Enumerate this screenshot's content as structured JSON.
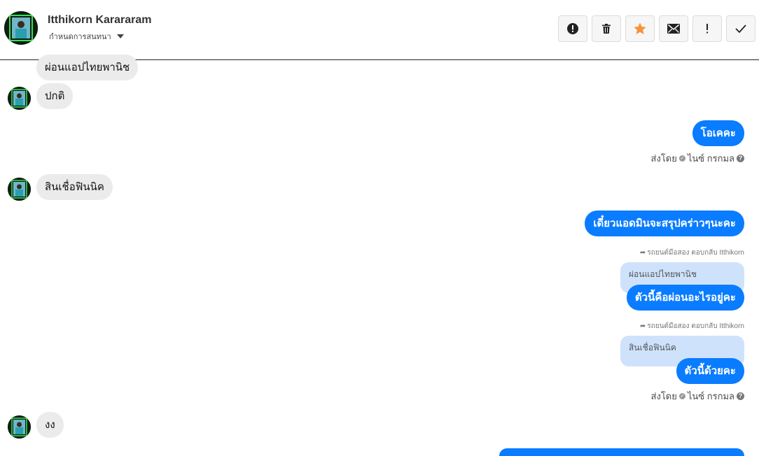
{
  "header": {
    "contact_name": "Itthikorn Karararam",
    "subtitle": "กำหนดการสนทนา",
    "toolbar": [
      {
        "name": "report-button",
        "icon": "alert-circle-icon"
      },
      {
        "name": "delete-button",
        "icon": "trash-icon"
      },
      {
        "name": "star-button",
        "icon": "star-icon"
      },
      {
        "name": "mail-button",
        "icon": "envelope-icon"
      },
      {
        "name": "important-button",
        "icon": "exclamation-icon"
      },
      {
        "name": "done-button",
        "icon": "check-icon"
      }
    ]
  },
  "colors": {
    "outgoing_bubble": "#0a7cff",
    "incoming_bubble": "#ebebeb",
    "quote_bubble": "#cfe2fc",
    "star": "#f7923a"
  },
  "messages": {
    "m1": {
      "text": "ผ่อนแอปไทยพานิช"
    },
    "m2": {
      "text": "ปกติ"
    },
    "m3": {
      "text": "โอเคคะ"
    },
    "m3_sent": {
      "label": "ส่งโดย",
      "name": "ไนซ์ กรกมล",
      "help": "?"
    },
    "m4": {
      "text": "สินเชื่อฟินนิค"
    },
    "m5": {
      "text": "เดี๋ยวแอดมินจะสรุปคร่าวๆนะคะ"
    },
    "m6_reply": {
      "label": "รถยนต์มือสอง ตอบกลับ Itthikorn"
    },
    "m6_quote": {
      "text": "ผ่อนแอปไทยพานิช"
    },
    "m6": {
      "text": "ตัวนี้คือผ่อนอะไรอยู่คะ"
    },
    "m7_reply": {
      "label": "รถยนต์มือสอง ตอบกลับ Itthikorn"
    },
    "m7_quote": {
      "text": "สินเชื่อฟินนิค"
    },
    "m7": {
      "text": "ตัวนี้ด้วยคะ"
    },
    "m7_sent": {
      "label": "ส่งโดย",
      "name": "ไนซ์ กรกมล",
      "help": "?"
    },
    "m8": {
      "text": "งง"
    }
  }
}
